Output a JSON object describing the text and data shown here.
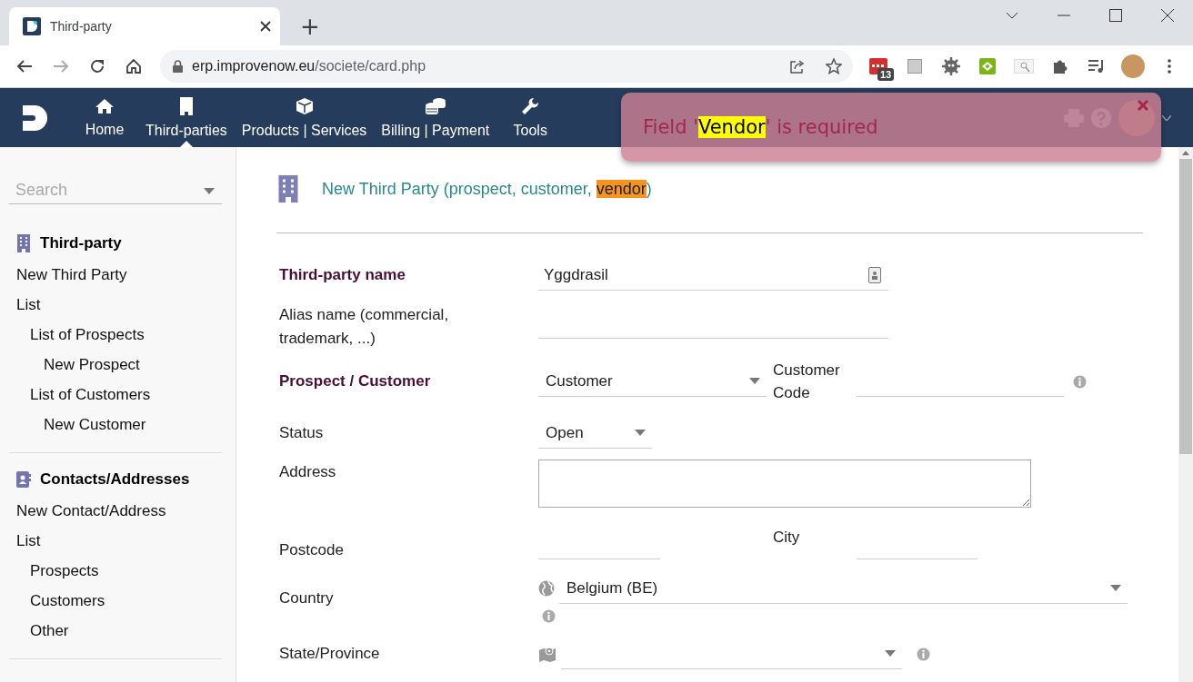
{
  "browser": {
    "tab_title": "Third-party",
    "new_tab": "+",
    "url_host": "erp.improvenow.eu",
    "url_path": "/societe/card.php",
    "extension_badge": "13"
  },
  "app": {
    "menu": [
      {
        "label": "Home",
        "selected": false
      },
      {
        "label": "Third-parties",
        "selected": true
      },
      {
        "label": "Products | Services",
        "selected": false
      },
      {
        "label": "Billing | Payment",
        "selected": false
      },
      {
        "label": "Tools",
        "selected": false
      }
    ]
  },
  "notification": {
    "before": "Field '",
    "highlight": "Vendor",
    "after": "' is required"
  },
  "sidebar": {
    "search_placeholder": "Search",
    "sections": [
      {
        "title": "Third-party",
        "items": [
          {
            "label": "New Third Party"
          },
          {
            "label": "List",
            "children": [
              {
                "label": "List of Prospects",
                "children": [
                  {
                    "label": "New Prospect"
                  }
                ]
              },
              {
                "label": "List of Customers",
                "children": [
                  {
                    "label": "New Customer"
                  }
                ]
              }
            ]
          }
        ]
      },
      {
        "title": "Contacts/Addresses",
        "items": [
          {
            "label": "New Contact/Address"
          },
          {
            "label": "List",
            "children": [
              {
                "label": "Prospects"
              },
              {
                "label": "Customers"
              },
              {
                "label": "Other"
              }
            ]
          }
        ]
      }
    ]
  },
  "page": {
    "title_before": "New Third Party (prospect, customer, ",
    "title_highlight": "vendor",
    "title_after": ")"
  },
  "form": {
    "rows": [
      {
        "kind": "text",
        "label": "Third-party name",
        "required": true,
        "value": "Yggdrasil",
        "lookup_icon": true
      },
      {
        "kind": "text",
        "label": "Alias name (commercial, trademark, ...)",
        "required": false
      },
      {
        "kind": "select_pair",
        "label": "Prospect / Customer",
        "required": true,
        "value": "Customer",
        "second_label": "Customer Code"
      },
      {
        "kind": "select",
        "label": "Status",
        "required": false,
        "value": "Open"
      },
      {
        "kind": "textarea",
        "label": "Address",
        "required": false
      },
      {
        "kind": "pair",
        "label": "Postcode",
        "required": false,
        "second_label": "City"
      },
      {
        "kind": "country",
        "label": "Country",
        "required": false,
        "value": "Belgium (BE)"
      },
      {
        "kind": "state",
        "label": "State/Province",
        "required": false
      }
    ]
  }
}
